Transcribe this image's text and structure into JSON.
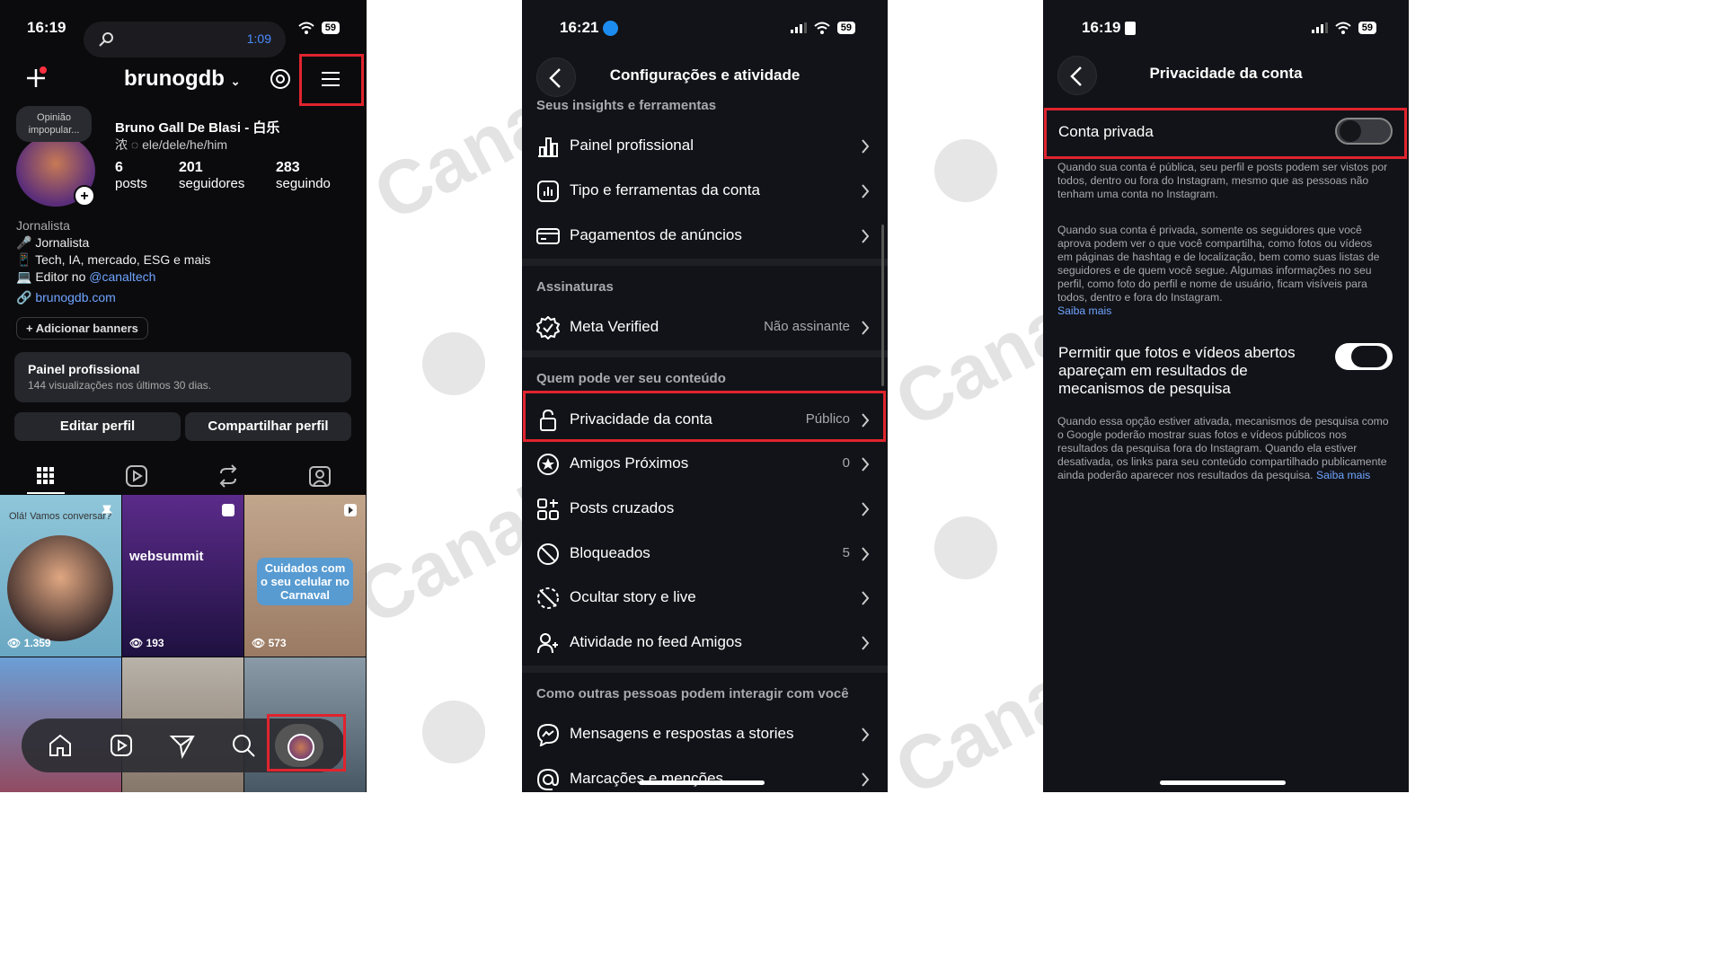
{
  "watermark": {
    "text": "Canaltech"
  },
  "screen1": {
    "status_time": "16:19",
    "timer": "1:09",
    "battery": "59",
    "username": "brunogdb",
    "bubble": "Opinião impopular...",
    "full_name": "Bruno Gall De Blasi - 白乐",
    "pronouns": "浓 ◌ ele/dele/he/him",
    "stats": [
      {
        "num": "6",
        "label": "posts"
      },
      {
        "num": "201",
        "label": "seguidores"
      },
      {
        "num": "283",
        "label": "seguindo"
      }
    ],
    "category": "Jornalista",
    "bio_line1": "🎤 Jornalista",
    "bio_line2": "📱 Tech, IA, mercado, ESG e mais",
    "bio_line3_prefix": "💻 Editor no ",
    "bio_line3_handle": "@canaltech",
    "website": "brunogdb.com",
    "add_banners": "+ Adicionar banners",
    "pro_title": "Painel profissional",
    "pro_sub": "144 visualizações nos últimos 30 dias.",
    "edit_profile": "Editar perfil",
    "share_profile": "Compartilhar perfil",
    "posts": [
      {
        "caption": "👁 1.359",
        "top_text": "Olá! Vamos conversar?"
      },
      {
        "caption": "👁 193",
        "overlay": "websummit"
      },
      {
        "caption": "👁 573",
        "overlay": "Cuidados com o seu celular no Carnaval"
      }
    ]
  },
  "screen2": {
    "status_time": "16:21",
    "battery": "59",
    "title": "Configurações e atividade",
    "section_insights": "Seus insights e ferramentas",
    "rows_insights": [
      {
        "label": "Painel profissional",
        "icon": "bar-chart-icon"
      },
      {
        "label": "Tipo e ferramentas da conta",
        "icon": "chart-box-icon"
      },
      {
        "label": "Pagamentos de anúncios",
        "icon": "credit-card-icon"
      }
    ],
    "section_subs": "Assinaturas",
    "row_meta": {
      "label": "Meta Verified",
      "value": "Não assinante"
    },
    "section_content": "Quem pode ver seu conteúdo",
    "rows_content": [
      {
        "label": "Privacidade da conta",
        "value": "Público",
        "icon": "lock-icon"
      },
      {
        "label": "Amigos Próximos",
        "value": "0",
        "icon": "star-circle-icon"
      },
      {
        "label": "Posts cruzados",
        "value": "",
        "icon": "grid-plus-icon"
      },
      {
        "label": "Bloqueados",
        "value": "5",
        "icon": "block-icon"
      },
      {
        "label": "Ocultar story e live",
        "value": "",
        "icon": "hide-story-icon"
      },
      {
        "label": "Atividade no feed Amigos",
        "value": "",
        "icon": "friends-icon"
      }
    ],
    "section_interact": "Como outras pessoas podem interagir com você",
    "rows_interact": [
      {
        "label": "Mensagens e respostas a stories",
        "icon": "messenger-icon"
      },
      {
        "label": "Marcações e menções",
        "icon": "at-icon"
      }
    ]
  },
  "screen3": {
    "status_time": "16:19",
    "battery": "59",
    "title": "Privacidade da conta",
    "private_label": "Conta privada",
    "private_on": false,
    "public_desc": "Quando sua conta é pública, seu perfil e posts podem ser vistos por todos, dentro ou fora do Instagram, mesmo que as pessoas não tenham uma conta no Instagram.",
    "private_desc": "Quando sua conta é privada, somente os seguidores que você aprova podem ver o que você compartilha, como fotos ou vídeos em páginas de hashtag e de localização, bem como suas listas de seguidores e de quem você segue. Algumas informações no seu perfil, como foto do perfil e nome de usuário, ficam visíveis para todos, dentro e fora do Instagram.",
    "learn_more": "Saiba mais",
    "search_label": "Permitir que fotos e vídeos abertos apareçam em resultados de mecanismos de pesquisa",
    "search_on": true,
    "search_desc": "Quando essa opção estiver ativada, mecanismos de pesquisa como o Google poderão mostrar suas fotos e vídeos públicos nos resultados da pesquisa fora do Instagram. Quando ela estiver desativada, os links para seu conteúdo compartilhado publicamente ainda poderão aparecer nos resultados da pesquisa.",
    "learn_more2": "Saiba mais"
  },
  "colors": {
    "highlight": "#e0242e",
    "link": "#6fa4ff",
    "toggle_on": "#ffffff"
  }
}
